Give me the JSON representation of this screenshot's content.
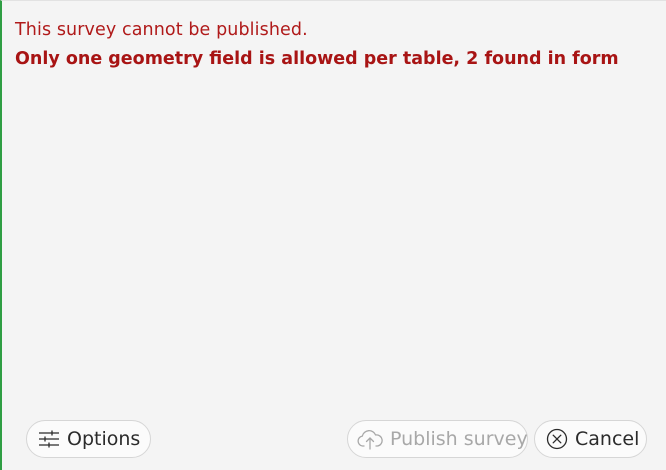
{
  "messages": {
    "error_title": "This survey cannot be published.",
    "error_detail": "Only one geometry field is allowed per table, 2 found in form"
  },
  "buttons": {
    "options_label": "Options",
    "publish_label": "Publish survey",
    "cancel_label": "Cancel"
  },
  "icons": {
    "options": "sliders-icon",
    "publish": "cloud-upload-icon",
    "cancel": "close-circle-icon"
  },
  "colors": {
    "error_text": "#b01a1a",
    "accent_border": "#2f9e44",
    "disabled_text": "#a8a8a8"
  },
  "state": {
    "publish_enabled": false
  }
}
